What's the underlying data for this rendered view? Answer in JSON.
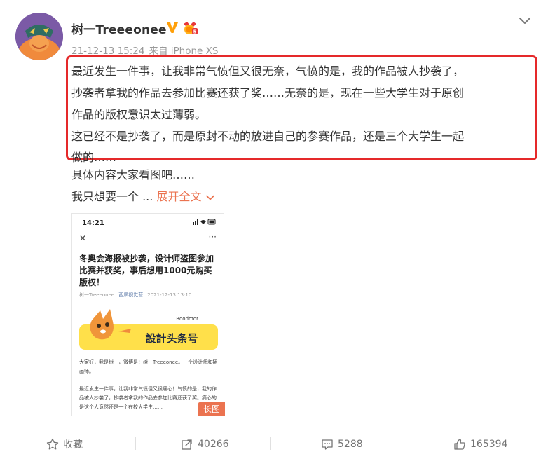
{
  "user": {
    "name": "树一Treeeonee",
    "timestamp": "21-12-13 15:24",
    "source": "来自 iPhone XS",
    "colors": {
      "verified": "#ffa00a",
      "medal": "#e8373a"
    }
  },
  "post": {
    "highlighted_lines": [
      "最近发生一件事，让我非常气愤但又很无奈，气愤的是，我的作品被人抄袭了，",
      "抄袭者拿我的作品去参加比赛还获了奖……无奈的是，现在一些大学生对于原创",
      "作品的版权意识太过薄弱。",
      "这已经不是抄袭了，而是原封不动的放进自己的参赛作品，还是三个大学生一起",
      "做的……"
    ],
    "line6": "具体内容大家看图吧……",
    "line7": "我只想要一个 ...",
    "expand_label": "展开全文",
    "highlight_color": "#e5292a",
    "link_color": "#eb7350"
  },
  "thumbnail": {
    "status_time": "14:21",
    "close": "✕",
    "menu": "···",
    "article_title": "冬奥会海报被抄袭，设计师盗图参加比赛并获奖，事后想用1000元购买版权！",
    "article_author": "树一Treeeonee",
    "article_publisher": "酉夙视觉营",
    "article_date": "2021-12-13 13:10",
    "banner_brand": "Boodmor",
    "banner_text": "設計头条号",
    "intro": "大家好，我是树一，微博是：树一Treeeonee。一个设计师和插画师。",
    "body": "最近发生一件事，让我非常气愤但又很痛心！气愤的是，我的作品被人抄袭了，抄袭者拿我的作品去参加比赛还获了奖。痛心的是这个人竟然还是一个在校大学生……",
    "long_tag": "长图"
  },
  "actions": {
    "favorite": "收藏",
    "repost": "40266",
    "comment": "5288",
    "like": "165394"
  }
}
